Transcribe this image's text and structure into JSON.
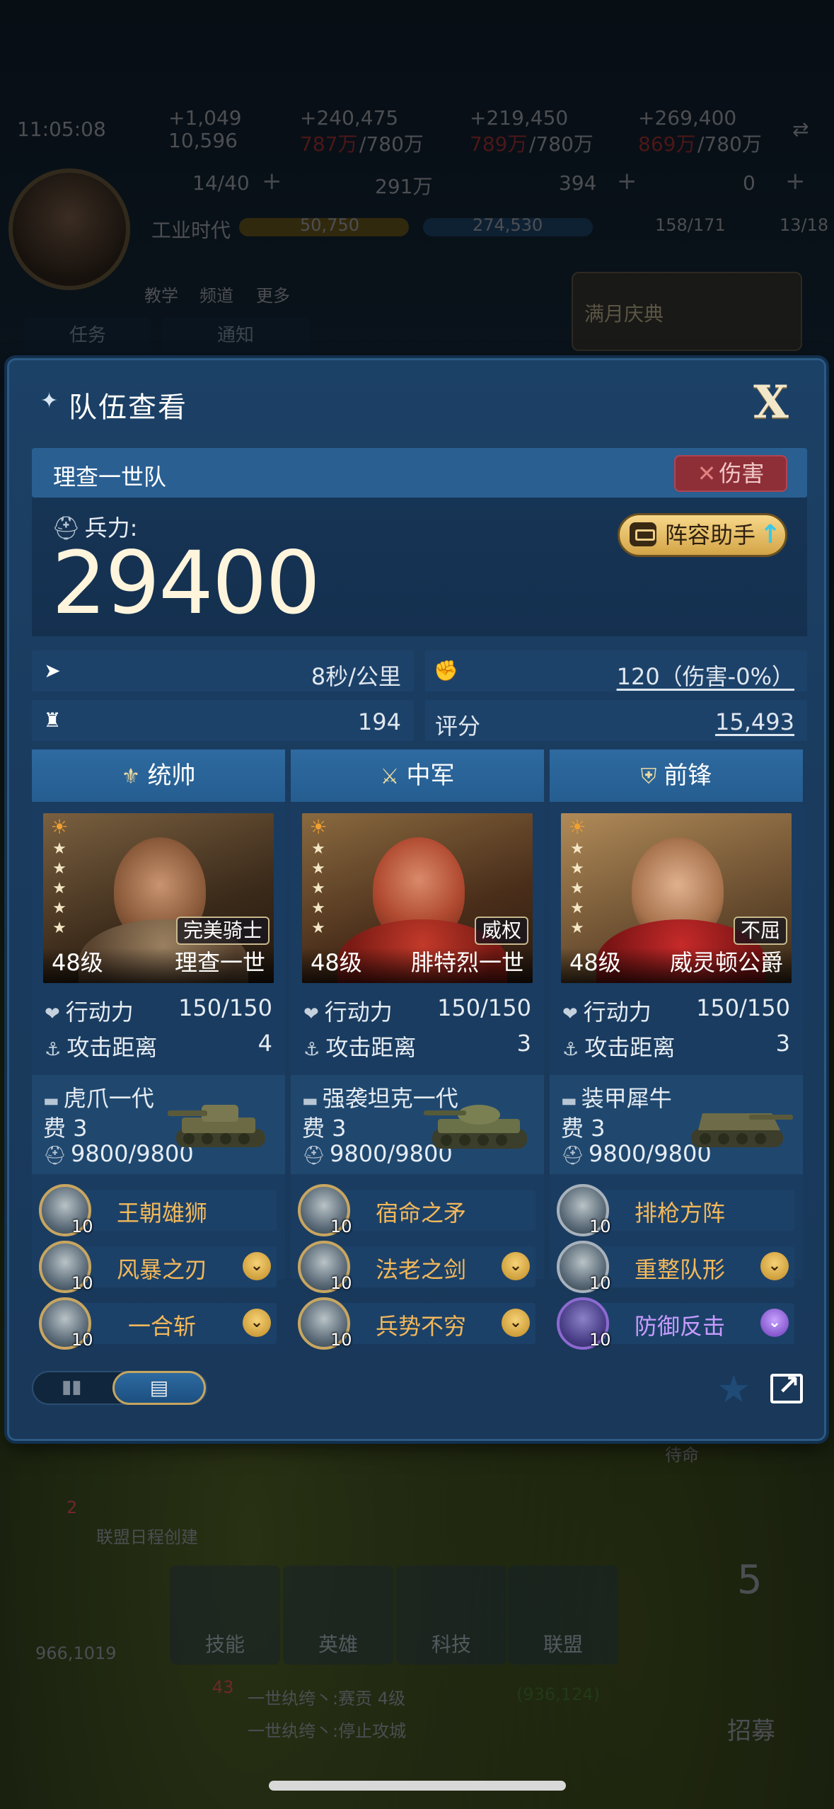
{
  "status": {
    "time": "11:05:08"
  },
  "resources": [
    {
      "name": "troops",
      "delta": "+1,049",
      "amount": "10,596",
      "amount_red": "",
      "cap": ""
    },
    {
      "name": "food",
      "delta": "+240,475",
      "amount": "",
      "amount_red": "787万",
      "cap": "/780万"
    },
    {
      "name": "wood",
      "delta": "+219,450",
      "amount": "",
      "amount_red": "789万",
      "cap": "/780万"
    },
    {
      "name": "oil",
      "delta": "+269,400",
      "amount": "",
      "amount_red": "869万",
      "cap": "/780万"
    }
  ],
  "currency": {
    "stamina": "14/40",
    "silver": "291万",
    "gold": "394",
    "diamond": "0"
  },
  "era": {
    "label": "工业时代",
    "progress1": "50,750",
    "progress2": "274,530",
    "troop_count": "158/171",
    "building_count": "13/18"
  },
  "top_nav": {
    "teach": "教学",
    "channel": "频道",
    "more": "更多",
    "tab_task": "任务",
    "tab_notice": "通知",
    "event": "满月庆典"
  },
  "bottom_nav": {
    "skill": "技能",
    "hero": "英雄",
    "tech": "科技",
    "alliance": "联盟",
    "recruit": "招募",
    "recruit_count": "5",
    "mail_badge": "2",
    "mail_text": "联盟日程创建",
    "coords": "966,1019",
    "chat_badge": "43",
    "chat1": "一世纨绔丶:赛贡 4级",
    "chat1_coords": "(936,124)",
    "chat2": "一世纨绔丶:停止攻城",
    "waiting": "待命"
  },
  "dialog": {
    "title": "队伍查看",
    "close": "X",
    "team_name": "理查一世队",
    "damage_badge": "伤害",
    "power_label": "兵力:",
    "power_value": "29400",
    "helper_btn": "阵容助手",
    "stats": {
      "speed": "8秒/公里",
      "attack": "120（伤害-0%）",
      "siege": "194",
      "score_label": "评分",
      "score": "15,493"
    },
    "heroes": [
      {
        "position": "统帅",
        "stars": 5,
        "trait": "完美骑士",
        "level": "48级",
        "name": "理查一世",
        "action_label": "行动力",
        "action": "150/150",
        "range_label": "攻击距离",
        "range": "4",
        "tank": "虎爪一代",
        "cost": "费 3",
        "hp": "9800/9800",
        "skills": [
          {
            "name": "王朝雄狮",
            "level": "10",
            "chevron": false,
            "style": "gold"
          },
          {
            "name": "风暴之刃",
            "level": "10",
            "chevron": true,
            "style": "gold"
          },
          {
            "name": "一合斩",
            "level": "10",
            "chevron": true,
            "style": "gold"
          }
        ]
      },
      {
        "position": "中军",
        "stars": 5,
        "trait": "威权",
        "level": "48级",
        "name": "腓特烈一世",
        "action_label": "行动力",
        "action": "150/150",
        "range_label": "攻击距离",
        "range": "3",
        "tank": "强袭坦克一代",
        "cost": "费 3",
        "hp": "9800/9800",
        "skills": [
          {
            "name": "宿命之矛",
            "level": "10",
            "chevron": false,
            "style": "gold"
          },
          {
            "name": "法老之剑",
            "level": "10",
            "chevron": true,
            "style": "gold"
          },
          {
            "name": "兵势不穷",
            "level": "10",
            "chevron": true,
            "style": "gold"
          }
        ]
      },
      {
        "position": "前锋",
        "stars": 5,
        "trait": "不屈",
        "level": "48级",
        "name": "威灵顿公爵",
        "action_label": "行动力",
        "action": "150/150",
        "range_label": "攻击距离",
        "range": "3",
        "tank": "装甲犀牛",
        "cost": "费 3",
        "hp": "9800/9800",
        "skills": [
          {
            "name": "排枪方阵",
            "level": "10",
            "chevron": false,
            "style": "grey"
          },
          {
            "name": "重整队形",
            "level": "10",
            "chevron": true,
            "style": "grey"
          },
          {
            "name": "防御反击",
            "level": "10",
            "chevron": true,
            "style": "purple"
          }
        ]
      }
    ],
    "toggle_left": "▮▮",
    "toggle_right": "▤"
  },
  "colors": {
    "accent_gold": "#f2b85a",
    "damage_red": "#8e2f38",
    "panel_blue": "#1a3b5e",
    "purple_skill": "#c79bff"
  }
}
